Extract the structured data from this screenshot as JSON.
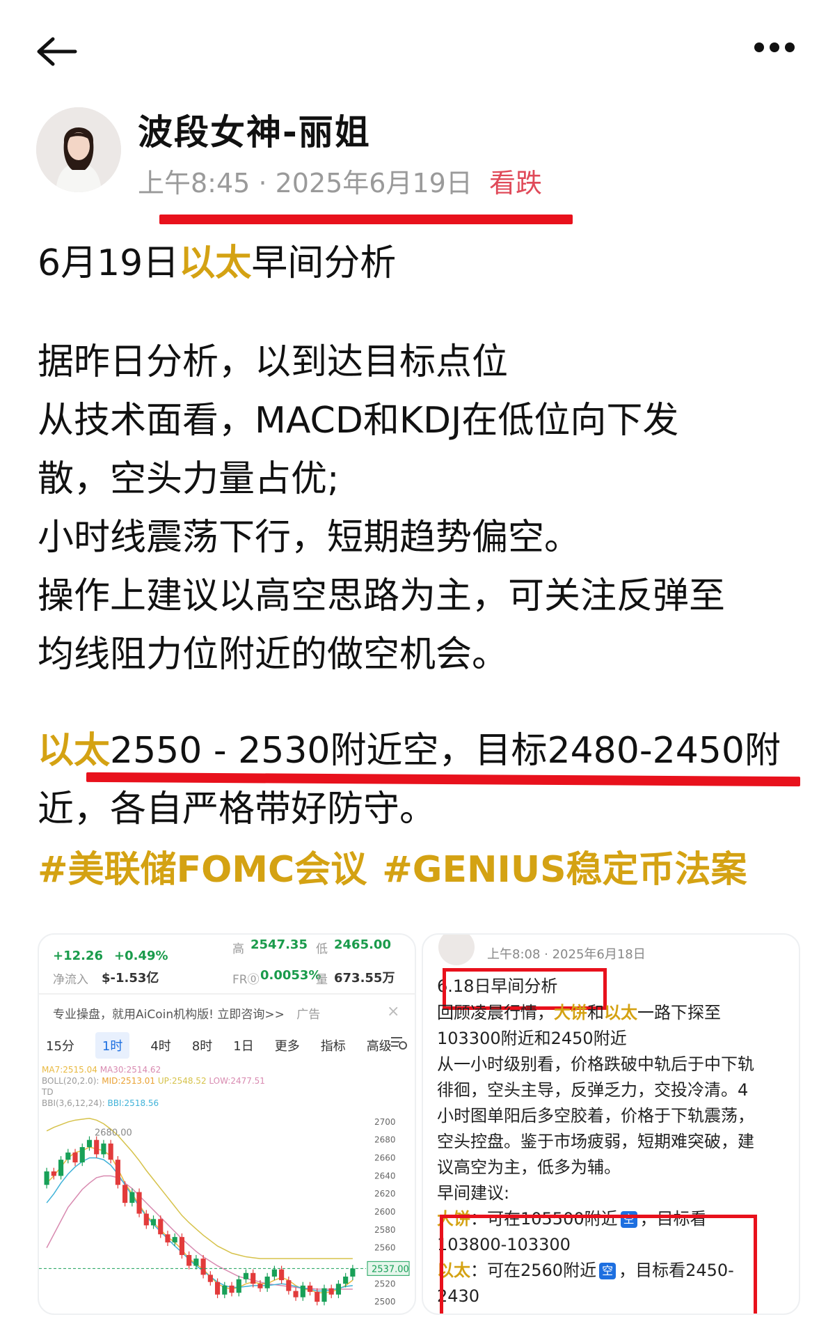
{
  "header": {
    "back_icon": "back-arrow-icon",
    "more_icon": "more-dots-icon"
  },
  "author": {
    "name": "波段女神-丽姐",
    "time": "上午8:45",
    "date": "· 2025年6月19日",
    "tag": "看跌"
  },
  "post": {
    "title_prefix": "6月19日",
    "title_highlight": "以太",
    "title_suffix": "早间分析",
    "paragraph": [
      "据昨日分析，以到达目标点位",
      "从技术面看，MACD和KDJ在低位向下发",
      "散，空头力量占优;",
      "小时线震荡下行，短期趋势偏空。",
      "操作上建议以高空思路为主，可关注反弹至",
      "均线阻力位附近的做空机会。"
    ],
    "signal_highlight": "以太",
    "signal_line1": "2550 - 2530附近空，目标2480-2450附",
    "signal_line2": "近，各自严格带好防守。",
    "hashtags": [
      "#美联储FOMC会议",
      "#GENIUS稳定币法案"
    ]
  },
  "chart_card": {
    "change": "+12.26",
    "change_pct": "+0.49%",
    "high_label": "高",
    "high": "2547.35",
    "low_label": "低",
    "low": "2465.00",
    "inflow_label": "净流入",
    "inflow": "$-1.53亿",
    "fr_label": "FR⓪",
    "fr": "0.0053%",
    "vol_label": "量",
    "vol": "673.55万",
    "ad_text": "专业操盘，就用AiCoin机构版! 立即咨询>>",
    "ad_tag": "广告",
    "tabs": [
      "15分",
      "1时",
      "4时",
      "8时",
      "1日",
      "更多",
      "指标",
      "高级"
    ],
    "active_tab": "1时",
    "ind1_a": "MA7:2515.04",
    "ind1_b": "MA30:2514.62",
    "ind2_a": "BOLL(20,2.0):",
    "ind2_b": "MID:2513.01",
    "ind2_c": "UP:2548.52",
    "ind2_d": "LOW:2477.51",
    "ind3": "TD",
    "ind4_a": "BBI(3,6,12,24):",
    "ind4_b": "BBI:2518.56",
    "peak_label": "2680.00",
    "price_tag": "2537.00",
    "colors": {
      "up": "#18a058",
      "down": "#e23b3b",
      "ma7": "#e9b940",
      "ma30": "#d88ab0",
      "boll_mid": "#e9a030",
      "boll_up": "#d6c24a",
      "bbi": "#3fb2d8"
    }
  },
  "chart_data": {
    "type": "line",
    "ylim": [
      2490,
      2710
    ],
    "y_ticks": [
      "2700",
      "2680",
      "2660",
      "2640",
      "2620",
      "2600",
      "2580",
      "2560",
      "2540",
      "2520",
      "2500"
    ],
    "candles": [
      {
        "o": 2630,
        "c": 2645
      },
      {
        "o": 2645,
        "c": 2640
      },
      {
        "o": 2640,
        "c": 2658
      },
      {
        "o": 2658,
        "c": 2666
      },
      {
        "o": 2666,
        "c": 2655
      },
      {
        "o": 2655,
        "c": 2672
      },
      {
        "o": 2672,
        "c": 2680
      },
      {
        "o": 2680,
        "c": 2664
      },
      {
        "o": 2664,
        "c": 2676
      },
      {
        "o": 2676,
        "c": 2658
      },
      {
        "o": 2658,
        "c": 2630
      },
      {
        "o": 2630,
        "c": 2610
      },
      {
        "o": 2610,
        "c": 2622
      },
      {
        "o": 2622,
        "c": 2598
      },
      {
        "o": 2598,
        "c": 2585
      },
      {
        "o": 2585,
        "c": 2592
      },
      {
        "o": 2592,
        "c": 2575
      },
      {
        "o": 2575,
        "c": 2566
      },
      {
        "o": 2566,
        "c": 2572
      },
      {
        "o": 2572,
        "c": 2552
      },
      {
        "o": 2552,
        "c": 2540
      },
      {
        "o": 2540,
        "c": 2548
      },
      {
        "o": 2548,
        "c": 2530
      },
      {
        "o": 2530,
        "c": 2522
      },
      {
        "o": 2522,
        "c": 2508
      },
      {
        "o": 2508,
        "c": 2518
      },
      {
        "o": 2518,
        "c": 2510
      },
      {
        "o": 2510,
        "c": 2525
      },
      {
        "o": 2525,
        "c": 2532
      },
      {
        "o": 2532,
        "c": 2520
      },
      {
        "o": 2520,
        "c": 2515
      },
      {
        "o": 2515,
        "c": 2528
      },
      {
        "o": 2528,
        "c": 2536
      },
      {
        "o": 2536,
        "c": 2524
      },
      {
        "o": 2524,
        "c": 2512
      },
      {
        "o": 2512,
        "c": 2505
      },
      {
        "o": 2505,
        "c": 2518
      },
      {
        "o": 2518,
        "c": 2511
      },
      {
        "o": 2511,
        "c": 2500
      },
      {
        "o": 2500,
        "c": 2515
      },
      {
        "o": 2515,
        "c": 2508
      },
      {
        "o": 2508,
        "c": 2520
      },
      {
        "o": 2520,
        "c": 2528
      },
      {
        "o": 2528,
        "c": 2537
      }
    ],
    "lines": [
      {
        "name": "MA7",
        "color": "#e9b940",
        "values": [
          2632,
          2640,
          2650,
          2660,
          2666,
          2668,
          2672,
          2670,
          2668,
          2662,
          2648,
          2632,
          2620,
          2608,
          2596,
          2588,
          2580,
          2572,
          2566,
          2558,
          2548,
          2542,
          2536,
          2528,
          2520,
          2516,
          2514,
          2516,
          2520,
          2522,
          2520,
          2520,
          2524,
          2527,
          2524,
          2518,
          2514,
          2513,
          2510,
          2510,
          2511,
          2514,
          2518,
          2524
        ]
      },
      {
        "name": "MA30",
        "color": "#d88ab0",
        "values": [
          2560,
          2575,
          2590,
          2605,
          2615,
          2625,
          2632,
          2638,
          2640,
          2640,
          2638,
          2632,
          2626,
          2618,
          2610,
          2602,
          2594,
          2586,
          2578,
          2570,
          2563,
          2556,
          2550,
          2545,
          2540,
          2536,
          2532,
          2528,
          2526,
          2524,
          2522,
          2520,
          2519,
          2518,
          2517,
          2516,
          2515,
          2515,
          2514,
          2514,
          2514,
          2514,
          2514,
          2514
        ]
      },
      {
        "name": "BOLL-UP",
        "color": "#d6c24a",
        "values": [
          2690,
          2694,
          2697,
          2700,
          2702,
          2703,
          2704,
          2702,
          2698,
          2692,
          2685,
          2676,
          2667,
          2657,
          2646,
          2636,
          2626,
          2616,
          2606,
          2596,
          2588,
          2581,
          2574,
          2568,
          2562,
          2558,
          2554,
          2552,
          2550,
          2549,
          2548,
          2548,
          2548,
          2548,
          2548,
          2548,
          2548,
          2548,
          2548,
          2548,
          2548,
          2548,
          2548,
          2548
        ]
      },
      {
        "name": "BBI",
        "color": "#3fb2d8",
        "values": [
          2610,
          2620,
          2632,
          2642,
          2650,
          2656,
          2660,
          2660,
          2658,
          2652,
          2642,
          2630,
          2618,
          2606,
          2595,
          2586,
          2578,
          2570,
          2562,
          2555,
          2547,
          2540,
          2534,
          2528,
          2522,
          2518,
          2516,
          2516,
          2517,
          2518,
          2518,
          2518,
          2519,
          2520,
          2519,
          2517,
          2515,
          2514,
          2512,
          2512,
          2513,
          2515,
          2517,
          2518
        ]
      }
    ]
  },
  "quoted_post": {
    "meta": "上午8:08 · 2025年6月18日",
    "title": "6.18日早间分析",
    "line1_a": "回顾凌晨行情，",
    "line1_gold1": "大饼",
    "line1_b": "和",
    "line1_gold2": "以太",
    "line1_c": "一路下探至",
    "line2": "103300附近和2450附近",
    "line3": "从一小时级别看，价格跌破中轨后于中下轨",
    "line4": "徘徊，空头主导，反弹乏力，交投冷清。4",
    "line5": "小时图单阳后多空胶着，价格于下轨震荡，",
    "line6": "空头控盘。鉴于市场疲弱，短期难突破，建",
    "line7": "议高空为主，低多为辅。",
    "line8": "早间建议:",
    "btc_label": "大饼",
    "btc_text": "：可在105500附近",
    "short_badge": "空",
    "btc_target": "，目标看",
    "btc_range": "103800-103300",
    "eth_label": "以太",
    "eth_text": "：可在2560附近",
    "eth_target": "，目标看2450-",
    "eth_range": "2430"
  }
}
